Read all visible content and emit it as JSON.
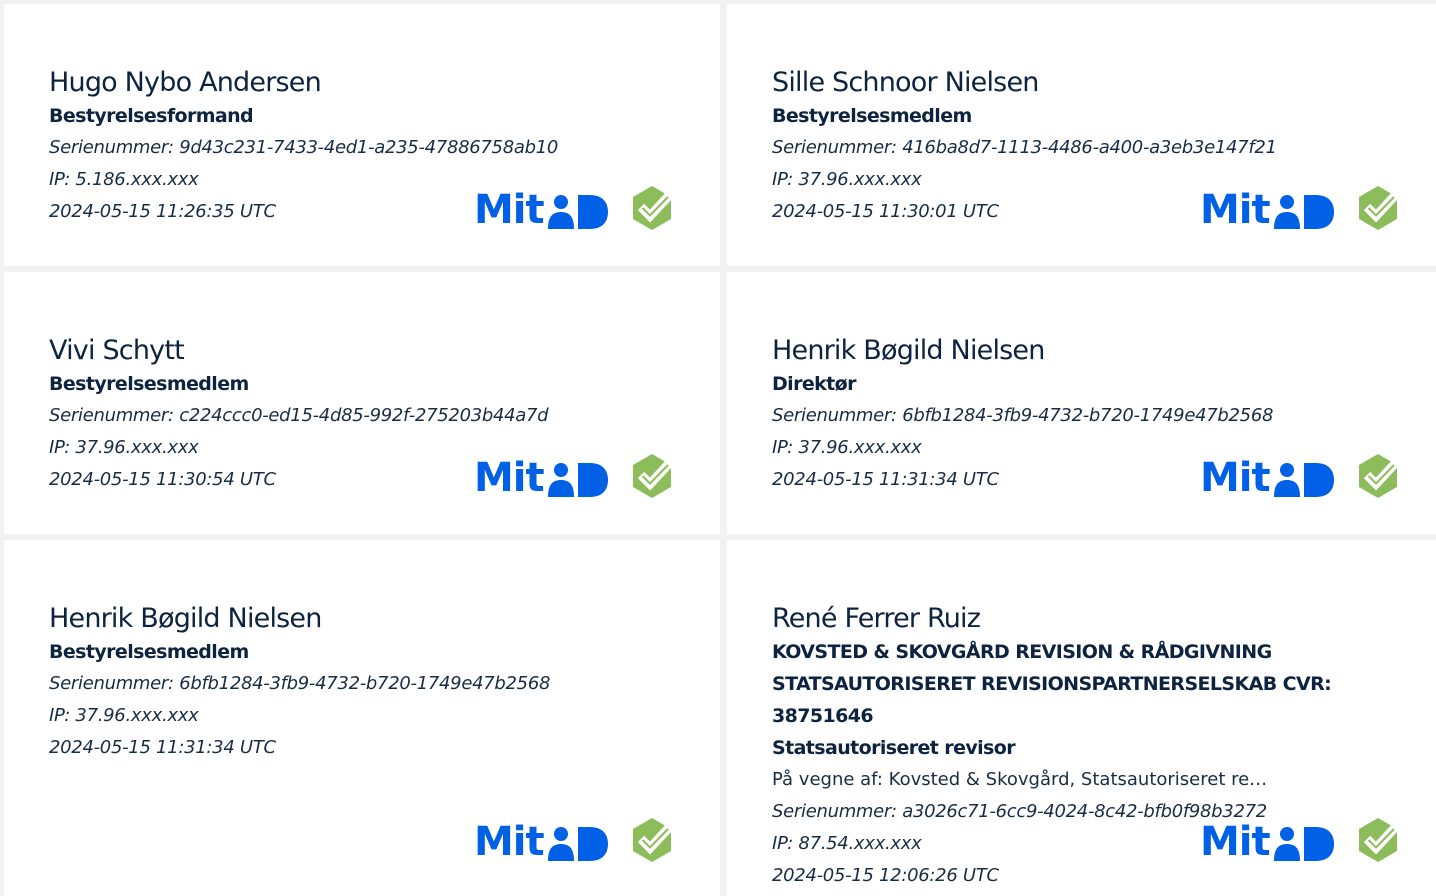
{
  "brand": {
    "logo_text": "Mit",
    "logo_color": "#0060e6",
    "check_color": "#8cbd5a",
    "icons": [
      "mitid-logo",
      "check-shield-icon"
    ]
  },
  "signers": [
    {
      "name": "Hugo Nybo Andersen",
      "role": "Bestyrelsesformand",
      "serial": "Serienummer: 9d43c231-7433-4ed1-a235-47886758ab10",
      "ip": "IP: 5.186.xxx.xxx",
      "timestamp": "2024-05-15 11:26:35 UTC"
    },
    {
      "name": "Sille Schnoor Nielsen",
      "role": "Bestyrelsesmedlem",
      "serial": "Serienummer: 416ba8d7-1113-4486-a400-a3eb3e147f21",
      "ip": "IP: 37.96.xxx.xxx",
      "timestamp": "2024-05-15 11:30:01 UTC"
    },
    {
      "name": "Vivi Schytt",
      "role": "Bestyrelsesmedlem",
      "serial": "Serienummer: c224ccc0-ed15-4d85-992f-275203b44a7d",
      "ip": "IP: 37.96.xxx.xxx",
      "timestamp": "2024-05-15 11:30:54 UTC"
    },
    {
      "name": "Henrik Bøgild Nielsen",
      "role": "Direktør",
      "serial": "Serienummer: 6bfb1284-3fb9-4732-b720-1749e47b2568",
      "ip": "IP: 37.96.xxx.xxx",
      "timestamp": "2024-05-15 11:31:34 UTC"
    },
    {
      "name": "Henrik Bøgild Nielsen",
      "role": "Bestyrelsesmedlem",
      "serial": "Serienummer: 6bfb1284-3fb9-4732-b720-1749e47b2568",
      "ip": "IP: 37.96.xxx.xxx",
      "timestamp": "2024-05-15 11:31:34 UTC"
    },
    {
      "name": "René Ferrer Ruiz",
      "company": "KOVSTED & SKOVGÅRD REVISION & RÅDGIVNING STATSAUTORISERET REVISIONSPARTNERSELSKAB CVR: 38751646",
      "role": "Statsautoriseret revisor",
      "on_behalf": "På vegne af: Kovsted & Skovgård, Statsautoriseret re…",
      "serial": "Serienummer: a3026c71-6cc9-4024-8c42-bfb0f98b3272",
      "ip": "IP: 87.54.xxx.xxx",
      "timestamp": "2024-05-15 12:06:26 UTC"
    }
  ]
}
